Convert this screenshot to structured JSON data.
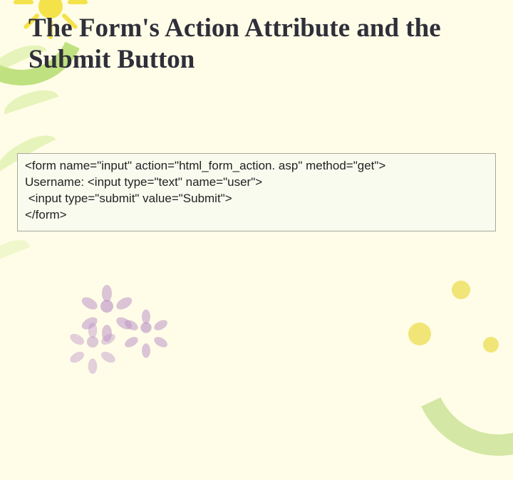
{
  "title": "The Form's Action Attribute and the Submit Button",
  "code": {
    "line1": "<form name=\"input\" action=\"html_form_action. asp\" method=\"get\">",
    "line2": "Username: <input type=\"text\" name=\"user\">",
    "line3": " <input type=\"submit\" value=\"Submit\">",
    "line4": "</form>"
  }
}
